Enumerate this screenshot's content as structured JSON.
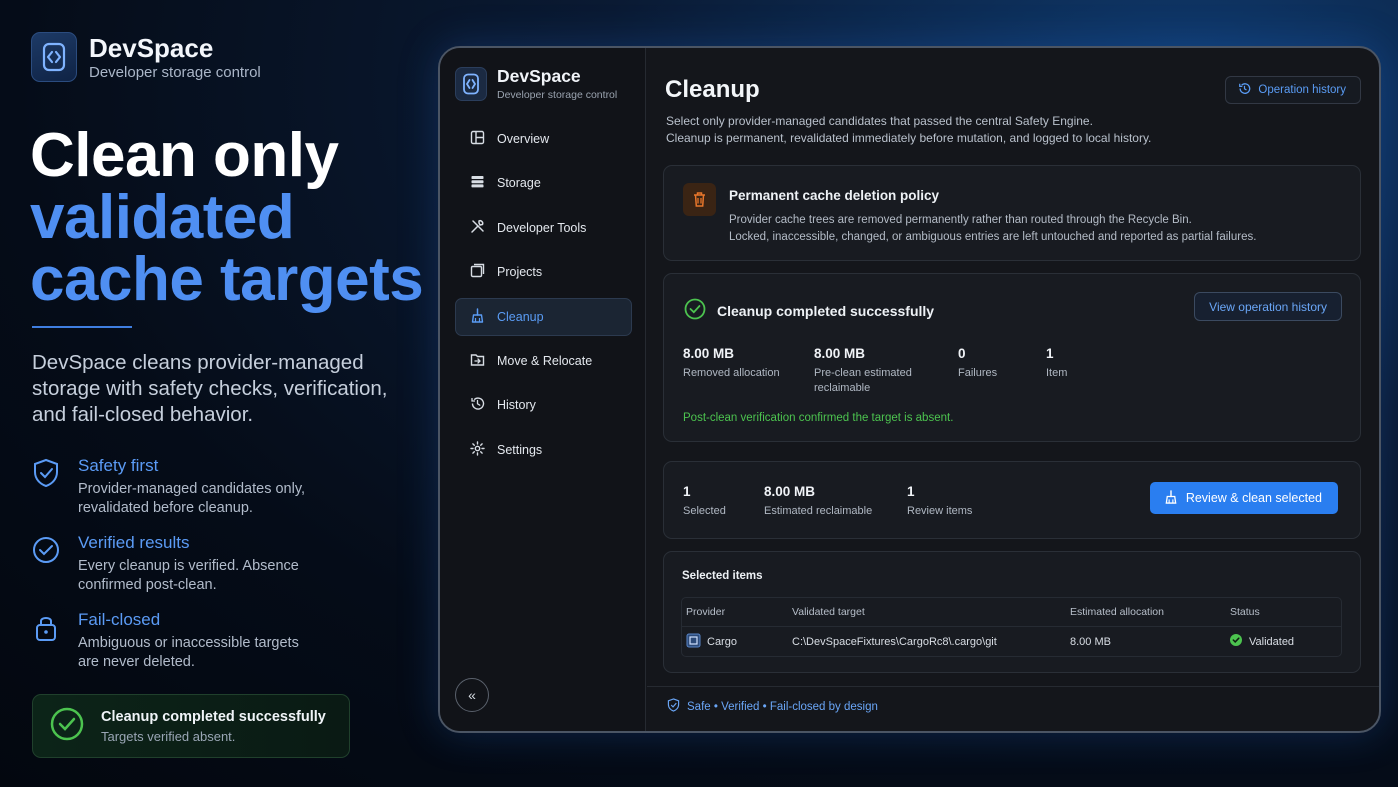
{
  "brand": {
    "name": "DevSpace",
    "subtitle": "Developer storage control"
  },
  "hero": {
    "line1": "Clean only",
    "line2": "validated",
    "line3": "cache targets"
  },
  "lead": "DevSpace cleans provider-managed storage with safety checks, verification, and fail-closed behavior.",
  "features": [
    {
      "icon": "shield-check-icon",
      "title": "Safety first",
      "desc": "Provider-managed candidates only, revalidated before cleanup."
    },
    {
      "icon": "check-circle-icon",
      "title": "Verified results",
      "desc": "Every cleanup is verified. Absence confirmed post-clean."
    },
    {
      "icon": "lock-icon",
      "title": "Fail-closed",
      "desc": "Ambiguous or inaccessible targets are never deleted."
    }
  ],
  "toast": {
    "title": "Cleanup completed successfully",
    "desc": "Targets verified absent."
  },
  "app": {
    "brand": {
      "name": "DevSpace",
      "subtitle": "Developer storage control"
    },
    "nav": [
      {
        "label": "Overview",
        "icon": "overview-icon",
        "active": false
      },
      {
        "label": "Storage",
        "icon": "storage-icon",
        "active": false
      },
      {
        "label": "Developer Tools",
        "icon": "tools-icon",
        "active": false
      },
      {
        "label": "Projects",
        "icon": "projects-icon",
        "active": false
      },
      {
        "label": "Cleanup",
        "icon": "broom-icon",
        "active": true
      },
      {
        "label": "Move & Relocate",
        "icon": "move-icon",
        "active": false
      },
      {
        "label": "History",
        "icon": "history-icon",
        "active": false
      },
      {
        "label": "Settings",
        "icon": "gear-icon",
        "active": false
      }
    ],
    "page": {
      "title": "Cleanup",
      "desc1": "Select only provider-managed candidates that passed the central Safety Engine.",
      "desc2": "Cleanup is permanent, revalidated immediately before mutation, and logged to local history.",
      "operation_history_label": "Operation history"
    },
    "policy": {
      "title": "Permanent cache deletion policy",
      "line1": "Provider cache trees are removed permanently rather than routed through the Recycle Bin.",
      "line2": "Locked, inaccessible, changed, or ambiguous entries are left untouched and reported as partial failures."
    },
    "result": {
      "title": "Cleanup completed successfully",
      "view_history_label": "View operation history",
      "stats": [
        {
          "value": "8.00 MB",
          "label": "Removed allocation"
        },
        {
          "value": "8.00 MB",
          "label": "Pre-clean estimated reclaimable"
        },
        {
          "value": "0",
          "label": "Failures"
        },
        {
          "value": "1",
          "label": "Item"
        }
      ],
      "verification": "Post-clean verification confirmed the target is absent."
    },
    "selection": {
      "stats": [
        {
          "value": "1",
          "label": "Selected"
        },
        {
          "value": "8.00 MB",
          "label": "Estimated reclaimable"
        },
        {
          "value": "1",
          "label": "Review items"
        }
      ],
      "review_button": "Review & clean selected"
    },
    "items": {
      "title": "Selected items",
      "columns": [
        "Provider",
        "Validated target",
        "Estimated allocation",
        "Status"
      ],
      "rows": [
        {
          "provider": "Cargo",
          "target": "C:\\DevSpaceFixtures\\CargoRc8\\.cargo\\git",
          "allocation": "8.00 MB",
          "status": "Validated"
        }
      ]
    },
    "footer": "Safe • Verified • Fail-closed by design"
  },
  "colors": {
    "accent": "#2a7ef0",
    "accent_text": "#5a9cf5",
    "success": "#4cc34f",
    "warning": "#e8762b"
  }
}
